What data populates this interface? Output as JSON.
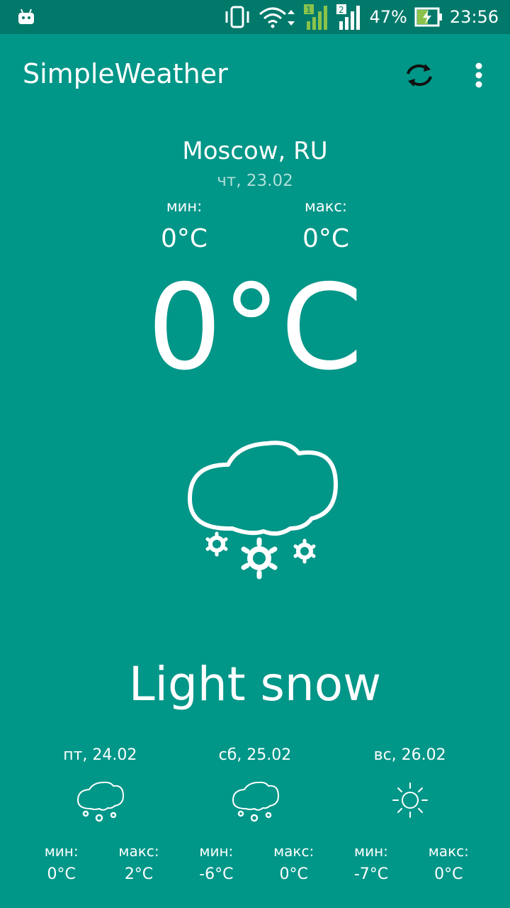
{
  "status_bar": {
    "battery": "47%",
    "time": "23:56",
    "sim1": "1",
    "sim2": "2",
    "icons": [
      "android-icon",
      "vibrate-icon",
      "wifi-icon",
      "signal-icon",
      "battery-charging-icon"
    ]
  },
  "app_bar": {
    "title": "SimpleWeather",
    "refresh_icon": "refresh-icon",
    "menu_icon": "more-vert-icon"
  },
  "current": {
    "city": "Moscow, RU",
    "date": "чт, 23.02",
    "min_label": "мин:",
    "max_label": "макс:",
    "min_value": "0°C",
    "max_value": "0°C",
    "temperature": "0°C",
    "icon": "light-snow-icon",
    "description": "Light snow"
  },
  "forecast": [
    {
      "date": "пт, 24.02",
      "icon": "light-snow-icon",
      "min_label": "мин:",
      "max_label": "макс:",
      "min_value": "0°C",
      "max_value": "2°C"
    },
    {
      "date": "сб, 25.02",
      "icon": "light-snow-icon",
      "min_label": "мин:",
      "max_label": "макс:",
      "min_value": "-6°C",
      "max_value": "0°C"
    },
    {
      "date": "вс, 26.02",
      "icon": "sun-icon",
      "min_label": "мин:",
      "max_label": "макс:",
      "min_value": "-7°C",
      "max_value": "0°C"
    }
  ],
  "colors": {
    "background": "#009688",
    "status_bar": "#00796b",
    "date_text": "#b2dfdb",
    "text": "#ffffff"
  }
}
